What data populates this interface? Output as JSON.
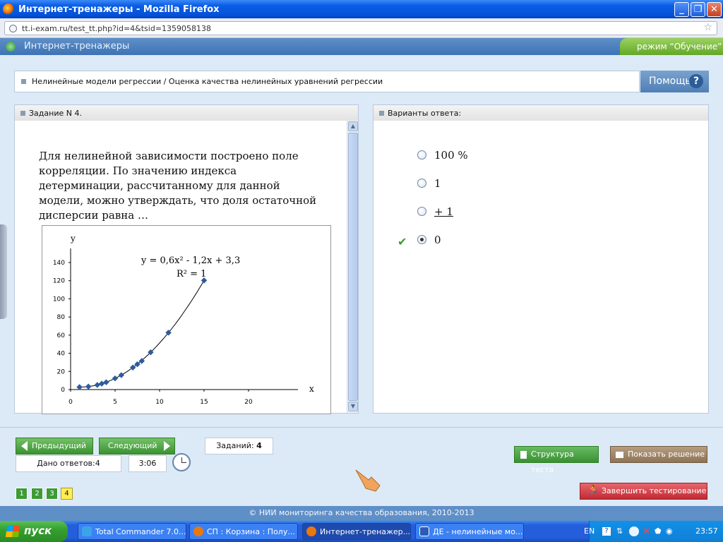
{
  "window": {
    "title": "Интернет-тренажеры - Mozilla Firefox"
  },
  "address": {
    "url": "tt.i-exam.ru/test_tt.php?id=4&tsid=1359058138"
  },
  "app": {
    "name": "Интернет-тренажеры",
    "mode": "режим “Обучение”"
  },
  "breadcrumb": "Нелинейные модели регрессии / Оценка качества нелинейных уравнений регрессии",
  "help_label": "Помощь",
  "task": {
    "header": "Задание N 4.",
    "text": "Для нелинейной зависимости построено поле корреляции. По значению индекса детерминации, рассчитанному для данной модели, можно утверждать, что доля остаточной дисперсии равна …"
  },
  "answers": {
    "header": "Варианты ответа:",
    "options": [
      {
        "label": "100 %",
        "selected": false
      },
      {
        "label": "1",
        "selected": false
      },
      {
        "label": "+ 1",
        "selected": false
      },
      {
        "label": "0",
        "selected": true
      }
    ]
  },
  "nav": {
    "prev": "Предыдущий",
    "next": "Следующий",
    "tasks_label": "Заданий:",
    "tasks_count": "4",
    "answered": "Дано ответов:4",
    "timer": "3:06",
    "pages": [
      "1",
      "2",
      "3",
      "4"
    ],
    "current_page": "4",
    "structure": "Структура теста",
    "show_solution": "Показать решение",
    "finish": "Завершить тестирование"
  },
  "footer": "© НИИ мониторинга качества образования, 2010-2013",
  "taskbar": {
    "start": "пуск",
    "items": [
      "Total Commander 7.0...",
      "СП : Корзина : Полу...",
      "Интернет-тренажер...",
      "ДЕ - нелинейные мо..."
    ],
    "active_index": 2,
    "lang": "EN",
    "time": "23:57"
  },
  "chart_data": {
    "type": "scatter",
    "xlabel": "x",
    "ylabel": "y",
    "xlim": [
      0,
      20
    ],
    "ylim": [
      0,
      140
    ],
    "xticks": [
      0,
      5,
      10,
      15,
      20
    ],
    "yticks": [
      0,
      20,
      40,
      60,
      80,
      100,
      120,
      140
    ],
    "equation": "y = 0,6x² - 1,2x + 3,3",
    "r2_label": "R² = 1",
    "points": [
      [
        1,
        2.7
      ],
      [
        2,
        3.3
      ],
      [
        3,
        5.1
      ],
      [
        3.5,
        6.5
      ],
      [
        4,
        8.1
      ],
      [
        5,
        12.3
      ],
      [
        5.7,
        15.9
      ],
      [
        7,
        24.3
      ],
      [
        7.5,
        27.9
      ],
      [
        8,
        31.5
      ],
      [
        9,
        41.1
      ],
      [
        11,
        62.7
      ],
      [
        15,
        120.3
      ]
    ]
  }
}
